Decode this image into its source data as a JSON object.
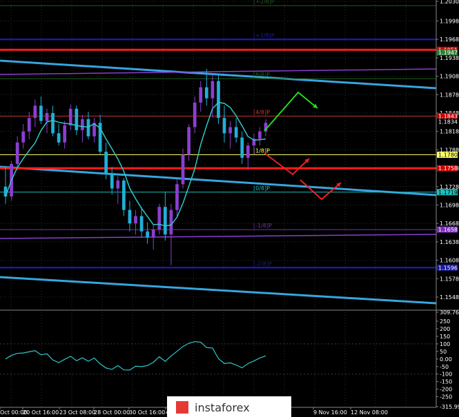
{
  "chart_data": {
    "type": "candlestick",
    "price_panel": {
      "ylim": [
        1.153,
        1.203
      ],
      "y_ticks": [
        "1.2030",
        "1.1998",
        "1.1968",
        "1.1938",
        "1.1908",
        "1.1878",
        "1.1848",
        "1.1818",
        "1.1788",
        "1.1758",
        "1.1728",
        "1.1698",
        "1.1668",
        "1.1638",
        "1.1608",
        "1.1578",
        "1.1548"
      ],
      "price_tags": [
        {
          "value": 1.1951,
          "label": "1.1951",
          "bg": "#cc0000",
          "color": "#ffffff"
        },
        {
          "value": 1.1947,
          "label": "1.1947",
          "bg": "#2e7d32",
          "color": "#ffffff"
        },
        {
          "value": 1.1843,
          "label": "1.1843",
          "bg": "#cc0000",
          "color": "#ffffff"
        },
        {
          "value": 1.1834,
          "label": "1.1834",
          "bg": "#000000",
          "color": "#ffffff"
        },
        {
          "value": 1.178,
          "label": "1.1780",
          "bg": "#ffff66",
          "color": "#000000"
        },
        {
          "value": 1.1758,
          "label": "1.1758",
          "bg": "#cc0000",
          "color": "#ffffff"
        },
        {
          "value": 1.1719,
          "label": "1.1719",
          "bg": "#20c0c0",
          "color": "#000000"
        },
        {
          "value": 1.1658,
          "label": "1.1658",
          "bg": "#7a2fb5",
          "color": "#ffffff"
        },
        {
          "value": 1.1596,
          "label": "1.1596",
          "bg": "#1a1aa0",
          "color": "#ffffff"
        }
      ],
      "murrey_levels": [
        {
          "label": "[+2/8]P",
          "value": 1.2023,
          "color": "#1f5f1f"
        },
        {
          "label": "[+1/8]P",
          "value": 1.1968,
          "color": "#1a1aa0"
        },
        {
          "label": "[8/8]P",
          "value": 1.1904,
          "color": "#1f5f1f"
        },
        {
          "label": "[4/8]P",
          "value": 1.1843,
          "color": "#cc3333"
        },
        {
          "label": "[1/8]P",
          "value": 1.178,
          "color": "#ffff66"
        },
        {
          "label": "[0/8]P",
          "value": 1.1719,
          "color": "#20c0c0"
        },
        {
          "label": "[-1/8]P",
          "value": 1.1658,
          "color": "#7a2fb5"
        },
        {
          "label": "[-2/8]P",
          "value": 1.1596,
          "color": "#1a1aa0"
        }
      ]
    },
    "indicator_panel": {
      "ylim": [
        -315.99,
        309.7635
      ],
      "y_ticks": [
        "309.7635",
        "250",
        "200",
        "150",
        "100",
        "50",
        "0.00",
        "-50",
        "-100",
        "-150",
        "-200",
        "-250",
        "-315.9900"
      ]
    },
    "x_ticks": [
      "Oct 00:00",
      "20 Oct 16:00",
      "23 Oct 08:00",
      "28 Oct 00:00",
      "30 Oct 16:00",
      "4",
      "9 Nov 16:00",
      "12 Nov 08:00"
    ],
    "candles": [
      [
        1.1728,
        1.176,
        1.17,
        1.1712
      ],
      [
        1.1712,
        1.177,
        1.1705,
        1.1765
      ],
      [
        1.1765,
        1.181,
        1.1755,
        1.18
      ],
      [
        1.18,
        1.183,
        1.179,
        1.1818
      ],
      [
        1.1818,
        1.185,
        1.1805,
        1.184
      ],
      [
        1.184,
        1.187,
        1.1825,
        1.186
      ],
      [
        1.186,
        1.1875,
        1.183,
        1.1835
      ],
      [
        1.1835,
        1.1855,
        1.1815,
        1.1848
      ],
      [
        1.1848,
        1.186,
        1.181,
        1.1815
      ],
      [
        1.1815,
        1.183,
        1.1795,
        1.18
      ],
      [
        1.18,
        1.1835,
        1.179,
        1.1828
      ],
      [
        1.1828,
        1.1862,
        1.182,
        1.1855
      ],
      [
        1.1855,
        1.186,
        1.1812,
        1.182
      ],
      [
        1.182,
        1.1845,
        1.18,
        1.1838
      ],
      [
        1.1838,
        1.185,
        1.1805,
        1.181
      ],
      [
        1.181,
        1.184,
        1.18,
        1.1832
      ],
      [
        1.1832,
        1.1845,
        1.178,
        1.1785
      ],
      [
        1.1785,
        1.18,
        1.174,
        1.1748
      ],
      [
        1.1748,
        1.176,
        1.1715,
        1.1725
      ],
      [
        1.1725,
        1.1745,
        1.17,
        1.1738
      ],
      [
        1.1738,
        1.1742,
        1.168,
        1.169
      ],
      [
        1.169,
        1.1705,
        1.1655,
        1.1668
      ],
      [
        1.1668,
        1.169,
        1.165,
        1.168
      ],
      [
        1.168,
        1.1695,
        1.1645,
        1.1655
      ],
      [
        1.1655,
        1.167,
        1.1635,
        1.1645
      ],
      [
        1.1645,
        1.1665,
        1.1625,
        1.1658
      ],
      [
        1.1658,
        1.17,
        1.165,
        1.1695
      ],
      [
        1.1695,
        1.172,
        1.164,
        1.165
      ],
      [
        1.165,
        1.17,
        1.16,
        1.169
      ],
      [
        1.169,
        1.174,
        1.168,
        1.1732
      ],
      [
        1.1732,
        1.179,
        1.1725,
        1.178
      ],
      [
        1.178,
        1.183,
        1.177,
        1.1825
      ],
      [
        1.1825,
        1.1875,
        1.1815,
        1.1865
      ],
      [
        1.1865,
        1.19,
        1.185,
        1.189
      ],
      [
        1.189,
        1.192,
        1.186,
        1.1872
      ],
      [
        1.1872,
        1.191,
        1.184,
        1.19
      ],
      [
        1.19,
        1.1912,
        1.183,
        1.184
      ],
      [
        1.184,
        1.186,
        1.18,
        1.1815
      ],
      [
        1.1815,
        1.1835,
        1.179,
        1.1825
      ],
      [
        1.1825,
        1.184,
        1.18,
        1.1808
      ],
      [
        1.1808,
        1.1818,
        1.1765,
        1.1775
      ],
      [
        1.1775,
        1.18,
        1.1755,
        1.1795
      ],
      [
        1.1795,
        1.1815,
        1.178,
        1.1806
      ],
      [
        1.1806,
        1.1825,
        1.1795,
        1.1818
      ],
      [
        1.1818,
        1.1838,
        1.181,
        1.1832
      ]
    ],
    "forecast_arrows": [
      {
        "color": "#22dd22",
        "points": [
          [
            383,
            190
          ],
          [
            432,
            134
          ],
          [
            460,
            157
          ]
        ]
      },
      {
        "color": "#ee2222",
        "points": [
          [
            383,
            222
          ],
          [
            424,
            253
          ],
          [
            448,
            230
          ]
        ]
      },
      {
        "color": "#ee2222",
        "points": [
          [
            435,
            261
          ],
          [
            466,
            289
          ],
          [
            494,
            265
          ]
        ]
      }
    ],
    "watermark": "instaforex"
  }
}
